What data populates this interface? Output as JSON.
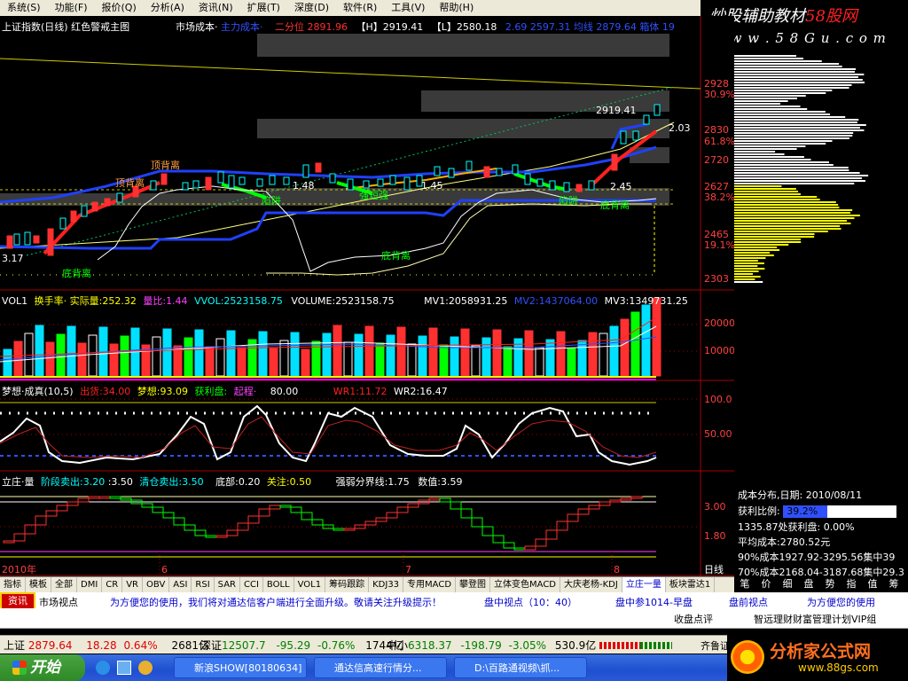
{
  "menu": [
    "系统(S)",
    "功能(F)",
    "报价(Q)",
    "分析(A)",
    "资讯(N)",
    "扩展(T)",
    "深度(D)",
    "软件(R)",
    "工具(V)",
    "帮助(H)"
  ],
  "brand": {
    "title_a": "炒股辅助教材",
    "title_b": "58股网",
    "url": "w w w . 5 8 G u . c o m"
  },
  "main_chart": {
    "title": "上证指数(日线) 红色警戒主图",
    "market_cost_label": "市场成本·",
    "market_cost_value": "主力成本·",
    "median_label": "二分位",
    "median_value": "2891.96",
    "high_label": "【H】",
    "high_value": "2919.41",
    "low_label": "【L】",
    "low_value": "2580.18",
    "extra": "2.69  2597.31  均线  2879.64  箱体  19",
    "price_labels": [
      "2919.41",
      "2.03",
      "2.45",
      "3.17",
      "1.45",
      "1.48"
    ],
    "annotations": [
      "顶背离",
      "顶背离",
      "陷阱",
      "强短强",
      "陷阱",
      "底背离",
      "底背离",
      "底背离"
    ],
    "y_axis": [
      "2928",
      "30.9%",
      "2830",
      "61.8%",
      "2720",
      "2627",
      "38.2%",
      "2465",
      "19.1%",
      "2303"
    ]
  },
  "vol_panel": {
    "title": "VOL1",
    "turnover_label": "换手率·",
    "actual_label": "实际量:",
    "actual_value": "252.32",
    "ratio_label": "量比:",
    "ratio_value": "1.44",
    "vvol_label": "VVOL:",
    "vvol_value": "2523158.75",
    "volume_label": "VOLUME:",
    "volume_value": "2523158.75",
    "mv1_label": "MV1:",
    "mv1_value": "2058931.25",
    "mv2_label": "MV2:",
    "mv2_value": "1437064.00",
    "mv3_label": "MV3:",
    "mv3_value": "1349731.25",
    "y_axis": [
      "20000",
      "10000"
    ]
  },
  "dream_panel": {
    "title": "梦想·成真(10,5)",
    "danger_label": "出货:",
    "danger_value": "34.00",
    "dream_label": "梦想:",
    "dream_value": "93.09",
    "profit_label": "获利盘:",
    "up_label": "起程·",
    "up_value": "80.00",
    "wr1_label": "WR1:",
    "wr1_value": "11.72",
    "wr2_label": "WR2:",
    "wr2_value": "16.47",
    "y_axis": [
      "100.0",
      "50.00"
    ]
  },
  "stand_panel": {
    "title": "立庄·量",
    "stage_sell_label": "阶段卖出:",
    "stage_sell_value": "3.20",
    "b_value": ":3.50",
    "clear_label": "清仓卖出:",
    "clear_value": "3.50",
    "bottom_label": "底部:",
    "bottom_value": "0.20",
    "focus_label": "关注:",
    "focus_value": "0.50",
    "strength_label": "强弱分界线:",
    "strength_value": "1.75",
    "num_label": "数值:",
    "num_value": "3.59",
    "y_axis": [
      "3.00",
      "1.80"
    ],
    "x_axis": [
      "2010年",
      "6",
      "7",
      "8"
    ],
    "period": "日线"
  },
  "cost_dist": {
    "date_label": "成本分布,日期:",
    "date": "2010/08/11",
    "profit_ratio_label": "获利比例:",
    "profit_ratio": "39.2%",
    "profit_line": "1335.87处获利盘: 0.00%",
    "avg_cost_label": "平均成本:",
    "avg_cost": "2780.52元",
    "c90": "90%成本1927.92-3295.56集中39",
    "c70": "70%成本2168.04-3187.68集中29.3"
  },
  "tabs": [
    "指标",
    "模板",
    "全部",
    "DMI",
    "CR",
    "VR",
    "OBV",
    "ASI",
    "RSI",
    "SAR",
    "CCI",
    "BOLL",
    "VOL1",
    "筹码跟踪",
    "KDJ33",
    "专用MACD",
    "攀登图",
    "立体变色MACD",
    "大庆老杨-KDJ",
    "立庄一量",
    "板块雷达1"
  ],
  "active_tab": "立庄一量",
  "right_tabs": [
    "笔",
    "价",
    "细",
    "盘",
    "势",
    "指",
    "值",
    "筹"
  ],
  "info_bar": {
    "left1": "资讯",
    "left2": "市场视点",
    "msg": "为方便您的使用，我们将对通达信客户端进行全面升级。敬请关注升级提示！",
    "b1": "盘中视点（10：40）",
    "b2": "盘中参1014-早盘",
    "b3": "盘前视点",
    "b4": "为方便您的使用"
  },
  "ticker": {
    "i1": "收盘点评",
    "i2": "智远理财财富管理计划VIP组"
  },
  "status": {
    "sh_name": "上证",
    "sh_value": "2879.64",
    "sh_change": "18.28",
    "sh_pct": "0.64%",
    "sh_amount": "2681亿",
    "sz_name": "深证",
    "sz_value": "12507.7",
    "sz_change": "-95.29",
    "sz_pct": "-0.76%",
    "sz_amount": "1744亿",
    "zx_name": "中小",
    "zx_value": "6318.37",
    "zx_change": "-198.79",
    "zx_pct": "-3.05%",
    "zx_amount": "530.9亿",
    "broker": "齐鲁证券"
  },
  "taskbar": {
    "start": "开始",
    "tasks": [
      "新浪SHOW[80180634]",
      "通达信高速行情分...",
      "D:\\百路通视频\\抓..."
    ]
  },
  "footer_brand": {
    "title": "分析家公式网",
    "url": "www.88gs.com"
  },
  "colors": {
    "up": "#ff2020",
    "down": "#00c0ff",
    "yellow": "#ffff00",
    "green": "#00ff00",
    "magenta": "#ff00ff"
  }
}
